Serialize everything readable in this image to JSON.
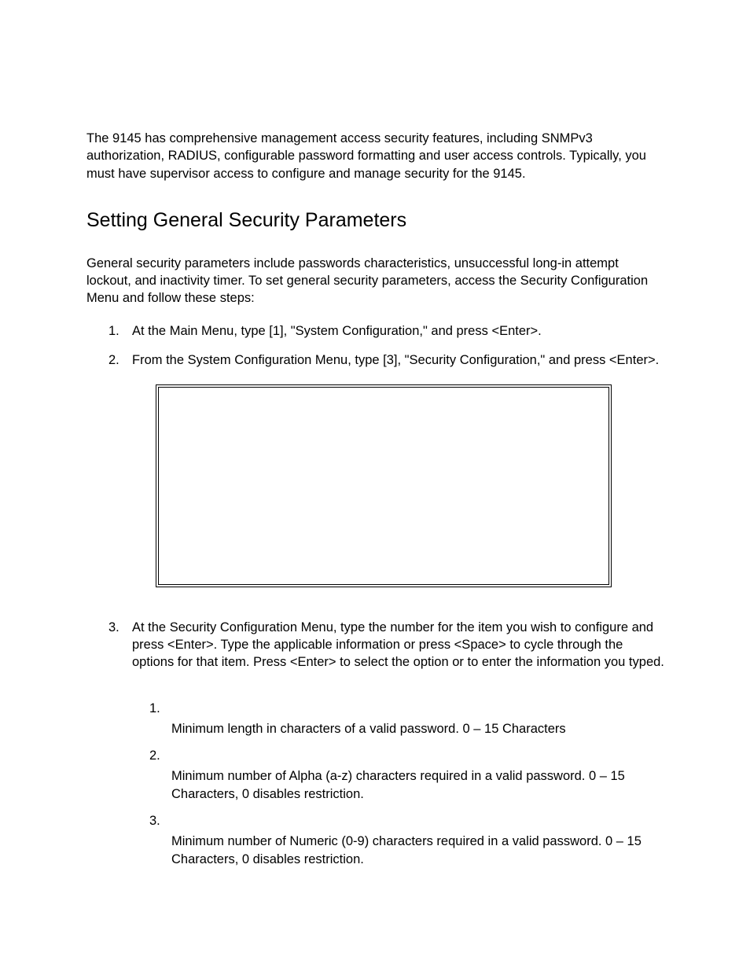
{
  "intro": "The 9145 has comprehensive management access security features, including SNMPv3 authorization, RADIUS, configurable password formatting and user access controls.  Typically, you must have supervisor access to configure and manage security for the 9145.",
  "sectionHeading": "Setting General Security Parameters",
  "sectionIntro": "General security parameters include passwords characteristics, unsuccessful long-in attempt lockout, and inactivity timer.  To set general security parameters, access the Security Configuration Menu and follow these steps:",
  "steps": {
    "step1": {
      "num": "1.",
      "text": "At the Main Menu, type [1], \"System Configuration,\" and press <Enter>."
    },
    "step2": {
      "num": "2.",
      "text": "From the System Configuration Menu, type [3], \"Security Configuration,\" and press <Enter>."
    },
    "step3": {
      "num": "3.",
      "text": "At the Security Configuration Menu, type the number for the item you wish to configure and press <Enter>.   Type the applicable information or press <Space> to cycle through the options for that item.  Press <Enter> to select the option or to enter the information you typed."
    }
  },
  "subItems": {
    "item1": {
      "num": "1.",
      "desc": "Minimum length in characters of a valid password.  0 – 15 Characters"
    },
    "item2": {
      "num": "2.",
      "desc": "Minimum number of Alpha (a-z) characters required in a valid password.  0 – 15 Characters, 0 disables restriction."
    },
    "item3": {
      "num": "3.",
      "desc": "Minimum number of Numeric (0-9) characters required in a valid password.  0 – 15 Characters, 0 disables restriction."
    }
  }
}
